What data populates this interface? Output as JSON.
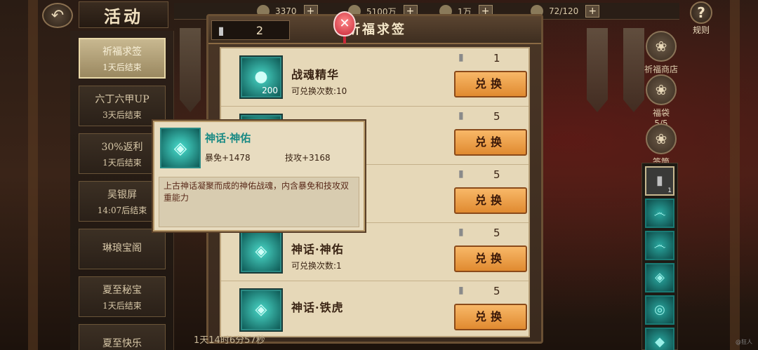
{
  "header": {
    "back_icon": "back-arrow-icon",
    "title": "活动",
    "rules_label": "规则"
  },
  "currencies": [
    {
      "icon": "coin-icon",
      "value": "3370"
    },
    {
      "icon": "silver-icon",
      "value": "5100万"
    },
    {
      "icon": "token-icon",
      "value": "1万"
    },
    {
      "icon": "stamina-icon",
      "value": "72/120"
    }
  ],
  "activities": [
    {
      "name": "祈福求签",
      "time": "1天后结束",
      "active": true
    },
    {
      "name": "六丁六甲UP",
      "time": "3天后结束",
      "active": false
    },
    {
      "name": "30%返利",
      "time": "1天后结束",
      "active": false
    },
    {
      "name": "吴银屏",
      "time": "14:07后结束",
      "active": false
    },
    {
      "name": "琳琅宝阁",
      "time": "",
      "active": false
    },
    {
      "name": "夏至秘宝",
      "time": "1天后结束",
      "active": false
    },
    {
      "name": "夏至快乐",
      "time": "",
      "active": false
    }
  ],
  "right_menu": [
    {
      "label": "祈福商店",
      "icon": "shop-icon"
    },
    {
      "label": "福袋",
      "sub": "5/5",
      "icon": "lucky-bag-icon"
    },
    {
      "label": "签筒",
      "icon": "sign-tube-icon"
    }
  ],
  "card_strip": [
    {
      "icon": "sign-icon",
      "count": "1"
    },
    {
      "icon": "dragon-card-icon",
      "count": ""
    },
    {
      "icon": "serpent-card-icon",
      "count": ""
    },
    {
      "icon": "shield-card-icon",
      "count": ""
    },
    {
      "icon": "ring-card-icon",
      "count": ""
    },
    {
      "icon": "misc-card-icon",
      "count": ""
    }
  ],
  "panel": {
    "title": "祈福求签",
    "sign_count": "2",
    "close_icon": "close-lantern-icon",
    "footer_time": "1天14时6分57秒"
  },
  "exchange_items": [
    {
      "name": "战魂精华",
      "sub": "可兑换次数:10",
      "cost": "1",
      "amount": "200",
      "button": "兑换"
    },
    {
      "name": "",
      "sub": "",
      "cost": "5",
      "amount": "",
      "button": "兑换"
    },
    {
      "name": "",
      "sub": "",
      "cost": "5",
      "amount": "",
      "button": "兑换"
    },
    {
      "name": "神话·神佑",
      "sub": "可兑换次数:1",
      "cost": "5",
      "amount": "",
      "button": "兑换"
    },
    {
      "name": "神话·铁虎",
      "sub": "",
      "cost": "5",
      "amount": "",
      "button": "兑换"
    }
  ],
  "tooltip": {
    "name": "神话·神佑",
    "stat1": "暴免+1478",
    "stat2": "技攻+3168",
    "desc": "上古神话凝聚而成的神佑战魂，内含暴免和技攻双重能力"
  },
  "watermark": "@狂人"
}
